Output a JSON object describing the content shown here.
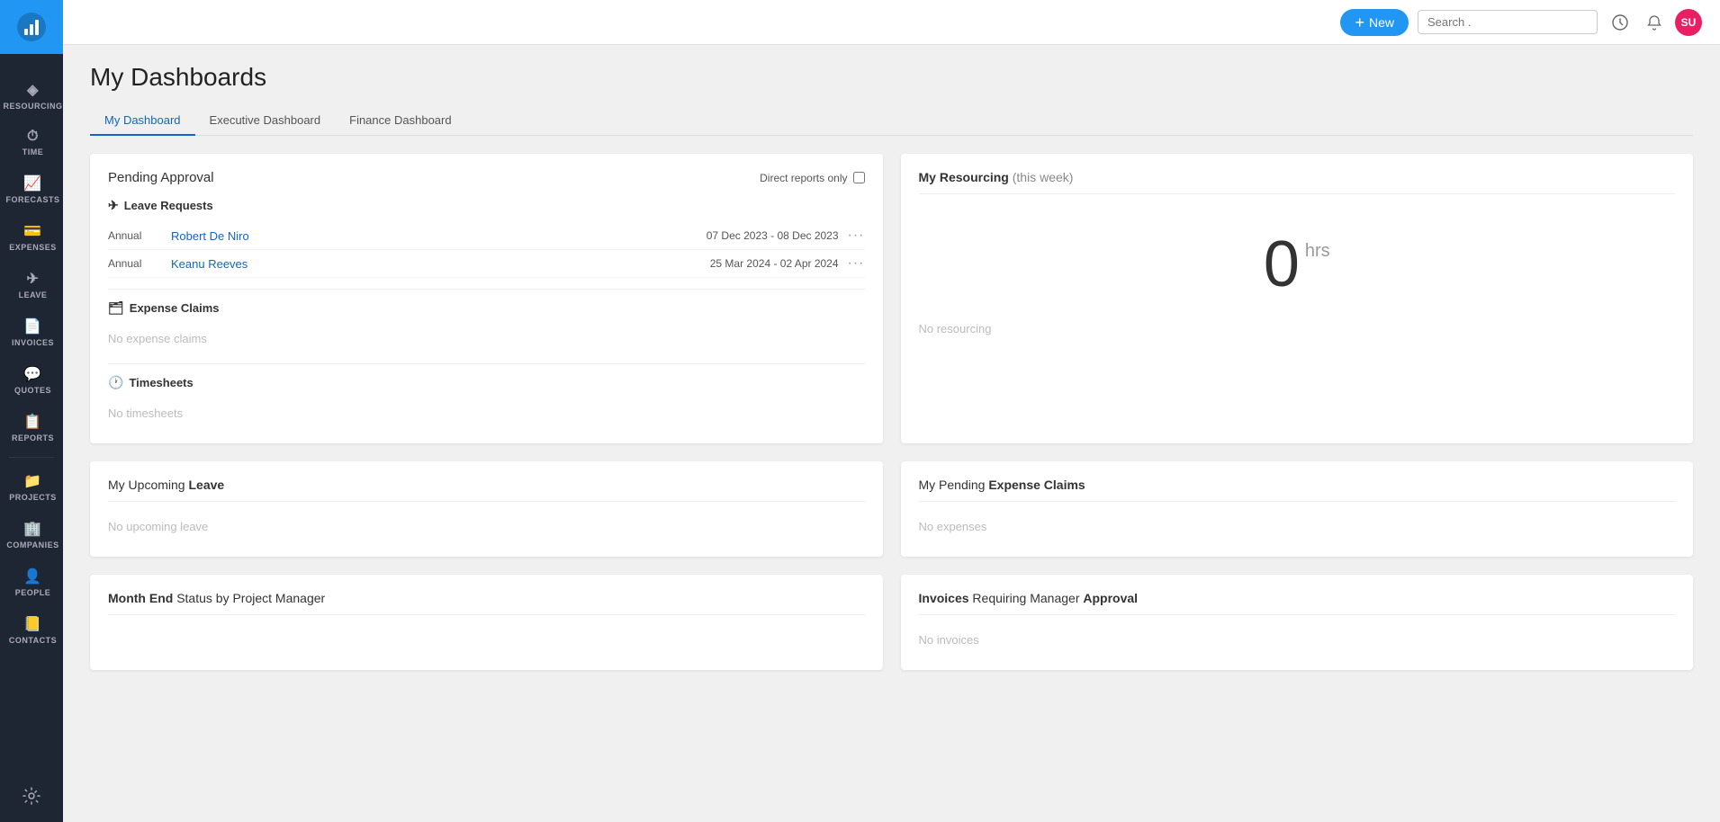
{
  "app": {
    "logo_text": "📊"
  },
  "sidebar": {
    "nav_items": [
      {
        "id": "resourcing",
        "label": "RESOURCING",
        "icon": "◈"
      },
      {
        "id": "time",
        "label": "TIME",
        "icon": "⏱"
      },
      {
        "id": "forecasts",
        "label": "FORECASTS",
        "icon": "📈"
      },
      {
        "id": "expenses",
        "label": "EXPENSES",
        "icon": "💳"
      },
      {
        "id": "leave",
        "label": "LEAVE",
        "icon": "✈"
      },
      {
        "id": "invoices",
        "label": "INVOICES",
        "icon": "📄"
      },
      {
        "id": "quotes",
        "label": "QUOTES",
        "icon": "💬"
      },
      {
        "id": "reports",
        "label": "REPORTS",
        "icon": "📋"
      },
      {
        "id": "projects",
        "label": "PROJECTS",
        "icon": "📁"
      },
      {
        "id": "companies",
        "label": "COMPANIES",
        "icon": "🏢"
      },
      {
        "id": "people",
        "label": "PEOPLE",
        "icon": "👤"
      },
      {
        "id": "contacts",
        "label": "CONTACTS",
        "icon": "📒"
      }
    ],
    "settings_label": "Settings"
  },
  "topbar": {
    "new_button_label": "New",
    "search_placeholder": "Search .",
    "avatar_initials": "SU"
  },
  "page": {
    "title": "My Dashboards"
  },
  "tabs": [
    {
      "id": "my-dashboard",
      "label": "My Dashboard",
      "active": true
    },
    {
      "id": "executive-dashboard",
      "label": "Executive Dashboard",
      "active": false
    },
    {
      "id": "finance-dashboard",
      "label": "Finance Dashboard",
      "active": false
    }
  ],
  "pending_approval": {
    "title": "Pending Approval",
    "direct_reports_label": "Direct reports only",
    "leave_requests_label": "Leave Requests",
    "leave_requests_icon": "✈",
    "leave_rows": [
      {
        "type": "Annual",
        "name": "Robert De Niro",
        "dates": "07 Dec 2023 - 08 Dec 2023"
      },
      {
        "type": "Annual",
        "name": "Keanu Reeves",
        "dates": "25 Mar 2024 - 02 Apr 2024"
      }
    ],
    "expense_claims_label": "Expense Claims",
    "expense_claims_icon": "🗂",
    "no_expense_claims": "No expense claims",
    "timesheets_label": "Timesheets",
    "timesheets_icon": "🕐",
    "no_timesheets": "No timesheets"
  },
  "my_resourcing": {
    "title": "My Resourcing",
    "period": "(this week)",
    "hours": "0",
    "hours_label": "hrs",
    "no_resourcing": "No resourcing"
  },
  "upcoming_leave": {
    "title": "My Upcoming",
    "title_bold": "Leave",
    "no_data": "No upcoming leave"
  },
  "pending_expense": {
    "title": "My Pending",
    "title_bold": "Expense Claims",
    "no_data": "No expenses"
  },
  "month_end": {
    "title": "Month End",
    "title_bold": "Status by Project Manager"
  },
  "invoices": {
    "title": "Invoices",
    "title_rest": "Requiring Manager",
    "title_bold2": "Approval",
    "no_data": "No invoices"
  }
}
